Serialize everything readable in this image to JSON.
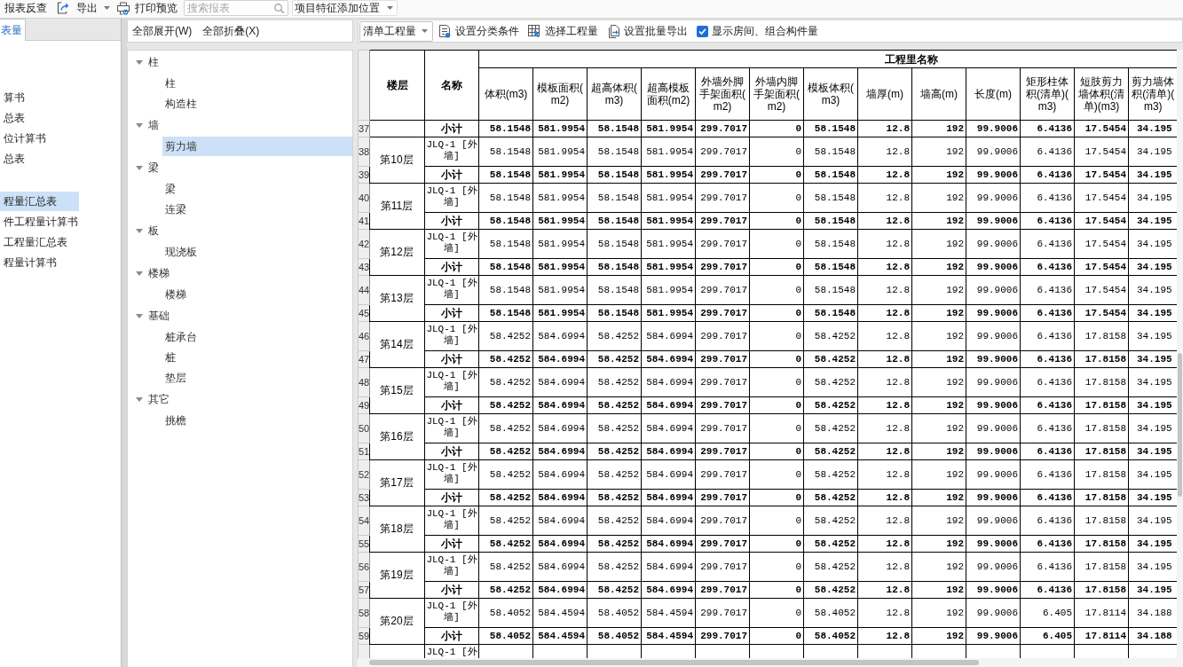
{
  "toolbar": {
    "reverse_check": {
      "label": "报表反查"
    },
    "export": {
      "label": "导出"
    },
    "print_preview": {
      "label": "打印预览"
    },
    "search": {
      "placeholder": "搜索报表"
    },
    "feature_position": {
      "label": "项目特征添加位置"
    }
  },
  "report_tabs": [
    {
      "label": "表量",
      "selected": true
    }
  ],
  "report_list": {
    "groups": [
      {
        "items": [
          {
            "label": "算书",
            "selected": false
          },
          {
            "label": "总表",
            "selected": false
          },
          {
            "label": "位计算书",
            "selected": false
          },
          {
            "label": "总表",
            "selected": false
          }
        ]
      },
      {
        "items": [
          {
            "label": "程量汇总表",
            "selected": true
          },
          {
            "label": "件工程量计算书",
            "selected": false
          },
          {
            "label": "工程量汇总表",
            "selected": false
          },
          {
            "label": "程量计算书",
            "selected": false
          }
        ]
      }
    ]
  },
  "tree": {
    "actions": [
      {
        "label": "全部展开(W)"
      },
      {
        "label": "全部折叠(X)"
      }
    ],
    "nodes": [
      {
        "label": "柱",
        "expanded": true,
        "children": [
          {
            "label": "柱",
            "selected": false
          },
          {
            "label": "构造柱",
            "selected": false
          }
        ]
      },
      {
        "label": "墙",
        "expanded": true,
        "children": [
          {
            "label": "剪力墙",
            "selected": true
          }
        ]
      },
      {
        "label": "梁",
        "expanded": true,
        "children": [
          {
            "label": "梁",
            "selected": false
          },
          {
            "label": "连梁",
            "selected": false
          }
        ]
      },
      {
        "label": "板",
        "expanded": true,
        "children": [
          {
            "label": "现浇板",
            "selected": false
          }
        ]
      },
      {
        "label": "楼梯",
        "expanded": true,
        "children": [
          {
            "label": "楼梯",
            "selected": false
          }
        ]
      },
      {
        "label": "基础",
        "expanded": true,
        "children": [
          {
            "label": "桩承台",
            "selected": false
          },
          {
            "label": "桩",
            "selected": false
          },
          {
            "label": "垫层",
            "selected": false
          }
        ]
      },
      {
        "label": "其它",
        "expanded": true,
        "children": [
          {
            "label": "挑檐",
            "selected": false
          }
        ]
      }
    ]
  },
  "quantity_toolbar": {
    "mode": {
      "value": "清单工程量"
    },
    "actions": [
      {
        "kind": "classify",
        "label": "设置分类条件"
      },
      {
        "kind": "select",
        "label": "选择工程量"
      },
      {
        "kind": "export",
        "label": "设置批量导出"
      }
    ],
    "show_rooms": {
      "label": "显示房间、组合构件量",
      "checked": true
    }
  },
  "table": {
    "floor_header": "楼层",
    "name_header": "名称",
    "group_header": "工程里名称",
    "columns": [
      "体积(m3)",
      "模板面积(m2)",
      "超高体积(m3)",
      "超高模板面积(m2)",
      "外墙外脚手架面积(m2)",
      "外墙内脚手架面积(m2)",
      "模板体积(m3)",
      "墙厚(m)",
      "墙高(m)",
      "长度(m)",
      "矩形柱体积(清单)(m3)",
      "短肢剪力墙体积(清单)(m3)",
      "剪力墙体积(清单)(m3)"
    ],
    "blocks": [
      {
        "rows": [
          {
            "num": "37",
            "kind": "subtotal",
            "name": "小计",
            "values": [
              "58.1548",
              "581.9954",
              "58.1548",
              "581.9954",
              "299.7017",
              "0",
              "58.1548",
              "12.8",
              "192",
              "99.9006",
              "6.4136",
              "17.5454",
              "34.195"
            ]
          }
        ]
      },
      {
        "floor": "第10层",
        "rows": [
          {
            "num": "38",
            "kind": "item",
            "name": "JLQ-1 [外墙]",
            "values": [
              "58.1548",
              "581.9954",
              "58.1548",
              "581.9954",
              "299.7017",
              "0",
              "58.1548",
              "12.8",
              "192",
              "99.9006",
              "6.4136",
              "17.5454",
              "34.195"
            ]
          },
          {
            "num": "39",
            "kind": "subtotal",
            "name": "小计",
            "values": [
              "58.1548",
              "581.9954",
              "58.1548",
              "581.9954",
              "299.7017",
              "0",
              "58.1548",
              "12.8",
              "192",
              "99.9006",
              "6.4136",
              "17.5454",
              "34.195"
            ]
          }
        ]
      },
      {
        "floor": "第11层",
        "rows": [
          {
            "num": "40",
            "kind": "item",
            "name": "JLQ-1 [外墙]",
            "values": [
              "58.1548",
              "581.9954",
              "58.1548",
              "581.9954",
              "299.7017",
              "0",
              "58.1548",
              "12.8",
              "192",
              "99.9006",
              "6.4136",
              "17.5454",
              "34.195"
            ]
          },
          {
            "num": "41",
            "kind": "subtotal",
            "name": "小计",
            "values": [
              "58.1548",
              "581.9954",
              "58.1548",
              "581.9954",
              "299.7017",
              "0",
              "58.1548",
              "12.8",
              "192",
              "99.9006",
              "6.4136",
              "17.5454",
              "34.195"
            ]
          }
        ]
      },
      {
        "floor": "第12层",
        "rows": [
          {
            "num": "42",
            "kind": "item",
            "name": "JLQ-1 [外墙]",
            "values": [
              "58.1548",
              "581.9954",
              "58.1548",
              "581.9954",
              "299.7017",
              "0",
              "58.1548",
              "12.8",
              "192",
              "99.9006",
              "6.4136",
              "17.5454",
              "34.195"
            ]
          },
          {
            "num": "43",
            "kind": "subtotal",
            "name": "小计",
            "values": [
              "58.1548",
              "581.9954",
              "58.1548",
              "581.9954",
              "299.7017",
              "0",
              "58.1548",
              "12.8",
              "192",
              "99.9006",
              "6.4136",
              "17.5454",
              "34.195"
            ]
          }
        ]
      },
      {
        "floor": "第13层",
        "rows": [
          {
            "num": "44",
            "kind": "item",
            "name": "JLQ-1 [外墙]",
            "values": [
              "58.1548",
              "581.9954",
              "58.1548",
              "581.9954",
              "299.7017",
              "0",
              "58.1548",
              "12.8",
              "192",
              "99.9006",
              "6.4136",
              "17.5454",
              "34.195"
            ]
          },
          {
            "num": "45",
            "kind": "subtotal",
            "name": "小计",
            "values": [
              "58.1548",
              "581.9954",
              "58.1548",
              "581.9954",
              "299.7017",
              "0",
              "58.1548",
              "12.8",
              "192",
              "99.9006",
              "6.4136",
              "17.5454",
              "34.195"
            ]
          }
        ]
      },
      {
        "floor": "第14层",
        "rows": [
          {
            "num": "46",
            "kind": "item",
            "name": "JLQ-1 [外墙]",
            "values": [
              "58.4252",
              "584.6994",
              "58.4252",
              "584.6994",
              "299.7017",
              "0",
              "58.4252",
              "12.8",
              "192",
              "99.9006",
              "6.4136",
              "17.8158",
              "34.195"
            ]
          },
          {
            "num": "47",
            "kind": "subtotal",
            "name": "小计",
            "values": [
              "58.4252",
              "584.6994",
              "58.4252",
              "584.6994",
              "299.7017",
              "0",
              "58.4252",
              "12.8",
              "192",
              "99.9006",
              "6.4136",
              "17.8158",
              "34.195"
            ]
          }
        ]
      },
      {
        "floor": "第15层",
        "rows": [
          {
            "num": "48",
            "kind": "item",
            "name": "JLQ-1 [外墙]",
            "values": [
              "58.4252",
              "584.6994",
              "58.4252",
              "584.6994",
              "299.7017",
              "0",
              "58.4252",
              "12.8",
              "192",
              "99.9006",
              "6.4136",
              "17.8158",
              "34.195"
            ]
          },
          {
            "num": "49",
            "kind": "subtotal",
            "name": "小计",
            "values": [
              "58.4252",
              "584.6994",
              "58.4252",
              "584.6994",
              "299.7017",
              "0",
              "58.4252",
              "12.8",
              "192",
              "99.9006",
              "6.4136",
              "17.8158",
              "34.195"
            ]
          }
        ]
      },
      {
        "floor": "第16层",
        "rows": [
          {
            "num": "50",
            "kind": "item",
            "name": "JLQ-1 [外墙]",
            "values": [
              "58.4252",
              "584.6994",
              "58.4252",
              "584.6994",
              "299.7017",
              "0",
              "58.4252",
              "12.8",
              "192",
              "99.9006",
              "6.4136",
              "17.8158",
              "34.195"
            ]
          },
          {
            "num": "51",
            "kind": "subtotal",
            "name": "小计",
            "values": [
              "58.4252",
              "584.6994",
              "58.4252",
              "584.6994",
              "299.7017",
              "0",
              "58.4252",
              "12.8",
              "192",
              "99.9006",
              "6.4136",
              "17.8158",
              "34.195"
            ]
          }
        ]
      },
      {
        "floor": "第17层",
        "rows": [
          {
            "num": "52",
            "kind": "item",
            "name": "JLQ-1 [外墙]",
            "values": [
              "58.4252",
              "584.6994",
              "58.4252",
              "584.6994",
              "299.7017",
              "0",
              "58.4252",
              "12.8",
              "192",
              "99.9006",
              "6.4136",
              "17.8158",
              "34.195"
            ]
          },
          {
            "num": "53",
            "kind": "subtotal",
            "name": "小计",
            "values": [
              "58.4252",
              "584.6994",
              "58.4252",
              "584.6994",
              "299.7017",
              "0",
              "58.4252",
              "12.8",
              "192",
              "99.9006",
              "6.4136",
              "17.8158",
              "34.195"
            ]
          }
        ]
      },
      {
        "floor": "第18层",
        "rows": [
          {
            "num": "54",
            "kind": "item",
            "name": "JLQ-1 [外墙]",
            "values": [
              "58.4252",
              "584.6994",
              "58.4252",
              "584.6994",
              "299.7017",
              "0",
              "58.4252",
              "12.8",
              "192",
              "99.9006",
              "6.4136",
              "17.8158",
              "34.195"
            ]
          },
          {
            "num": "55",
            "kind": "subtotal",
            "name": "小计",
            "values": [
              "58.4252",
              "584.6994",
              "58.4252",
              "584.6994",
              "299.7017",
              "0",
              "58.4252",
              "12.8",
              "192",
              "99.9006",
              "6.4136",
              "17.8158",
              "34.195"
            ]
          }
        ]
      },
      {
        "floor": "第19层",
        "rows": [
          {
            "num": "56",
            "kind": "item",
            "name": "JLQ-1 [外墙]",
            "values": [
              "58.4252",
              "584.6994",
              "58.4252",
              "584.6994",
              "299.7017",
              "0",
              "58.4252",
              "12.8",
              "192",
              "99.9006",
              "6.4136",
              "17.8158",
              "34.195"
            ]
          },
          {
            "num": "57",
            "kind": "subtotal",
            "name": "小计",
            "values": [
              "58.4252",
              "584.6994",
              "58.4252",
              "584.6994",
              "299.7017",
              "0",
              "58.4252",
              "12.8",
              "192",
              "99.9006",
              "6.4136",
              "17.8158",
              "34.195"
            ]
          }
        ]
      },
      {
        "floor": "第20层",
        "rows": [
          {
            "num": "58",
            "kind": "item",
            "name": "JLQ-1 [外墙]",
            "values": [
              "58.4052",
              "584.4594",
              "58.4052",
              "584.4594",
              "299.7017",
              "0",
              "58.4052",
              "12.8",
              "192",
              "99.9006",
              "6.405",
              "17.8114",
              "34.188"
            ]
          },
          {
            "num": "59",
            "kind": "subtotal",
            "name": "小计",
            "values": [
              "58.4052",
              "584.4594",
              "58.4052",
              "584.4594",
              "299.7017",
              "0",
              "58.4052",
              "12.8",
              "192",
              "99.9006",
              "6.405",
              "17.8114",
              "34.188"
            ]
          }
        ]
      },
      {
        "rows": [
          {
            "kind": "item",
            "name": "JLQ-1 [外"
          }
        ]
      }
    ]
  }
}
